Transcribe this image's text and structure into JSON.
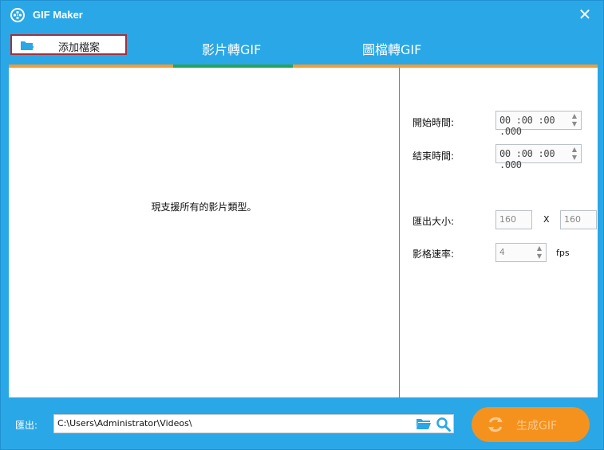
{
  "window": {
    "title": "GIF Maker",
    "close_glyph": "✕",
    "accent_color": "#2aa7e6"
  },
  "toolbar": {
    "add_file_label": "添加檔案",
    "tabs": [
      {
        "label": "影片轉GIF",
        "active": true
      },
      {
        "label": "圖檔轉GIF",
        "active": false
      }
    ],
    "active_tab_color": "#27a25a",
    "tab_strip_color": "#f39c34"
  },
  "preview": {
    "message": "現支援所有的影片類型。"
  },
  "settings": {
    "start_time": {
      "label": "開始時間:",
      "value": "00 :00 :00 .000"
    },
    "end_time": {
      "label": "結束時間:",
      "value": "00 :00 :00 .000"
    },
    "export_size": {
      "label": "匯出大小:",
      "width": "160",
      "separator": "X",
      "height": "160"
    },
    "frame_rate": {
      "label": "影格速率:",
      "value": "4",
      "unit": "fps"
    },
    "arrow_up": "▲",
    "arrow_down": "▼"
  },
  "footer": {
    "export_label": "匯出:",
    "path": "C:\\Users\\Administrator\\Videos\\",
    "generate_label": "生成GIF",
    "generate_color": "#f5921e",
    "icons": [
      "folder-icon",
      "search-icon",
      "refresh-icon"
    ]
  }
}
